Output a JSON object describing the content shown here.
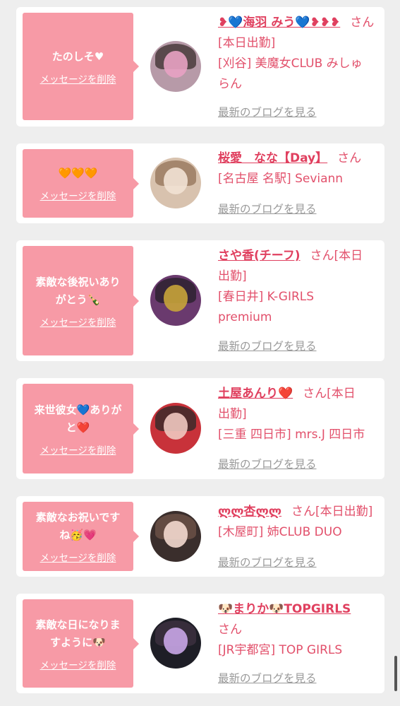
{
  "delete_label": "メッセージを削除",
  "blog_label": "最新のブログを見る",
  "san_label": "さん",
  "messages": [
    {
      "bubble_lines": [
        "たのしそ♥"
      ],
      "name": "❥💙海羽 みう💙❥❥❥",
      "suffix": "[本日出勤]",
      "info_lines": [
        "[刈谷] 美魔女CLUB みしゅ",
        "らん"
      ],
      "avatar_colors": [
        "#b79aa8",
        "#4a3b3c",
        "#e8a2c3"
      ]
    },
    {
      "bubble_lines": [
        "🧡🧡🧡"
      ],
      "name": "桜愛　なな【Day】",
      "suffix": "",
      "info_lines": [
        "[名古屋 名駅] Seviann"
      ],
      "avatar_colors": [
        "#d8c2ae",
        "#9b7b62",
        "#f2e2d4"
      ]
    },
    {
      "bubble_lines": [
        "素敵な後祝いあり",
        "がとう🍾"
      ],
      "name": "さや香(チーフ)",
      "suffix": "[本日",
      "info_lines": [
        "出勤]",
        "[春日井] K-GIRLS",
        "premium"
      ],
      "avatar_colors": [
        "#6a3a6e",
        "#2d2230",
        "#c8a43a"
      ]
    },
    {
      "bubble_lines": [
        "来世彼女💙ありが",
        "と❤️"
      ],
      "name": "土屋あんり❤️",
      "suffix": "[本日",
      "info_lines": [
        "出勤]",
        "[三重 四日市] mrs.J 四日市"
      ],
      "avatar_colors": [
        "#c8323a",
        "#3b2a2a",
        "#f0c8c0"
      ]
    },
    {
      "bubble_lines": [
        "素敵なお祝いです",
        "ね🥳💗"
      ],
      "name": "ლლ杏ლლ",
      "suffix": "[本日出勤]",
      "info_lines": [
        "[木屋町] 姉CLUB DUO"
      ],
      "avatar_colors": [
        "#3a2e2c",
        "#6b5046",
        "#f3d9cf"
      ]
    },
    {
      "bubble_lines": [
        "素敵な日になりま",
        "すように🐶"
      ],
      "name": "🐶まりか🐶TOPGIRLS",
      "suffix": "",
      "info_lines": [
        "さん",
        "[JR宇都宮] TOP GIRLS"
      ],
      "avatar_colors": [
        "#1e1e26",
        "#3c3040",
        "#c9a6e8"
      ]
    }
  ]
}
